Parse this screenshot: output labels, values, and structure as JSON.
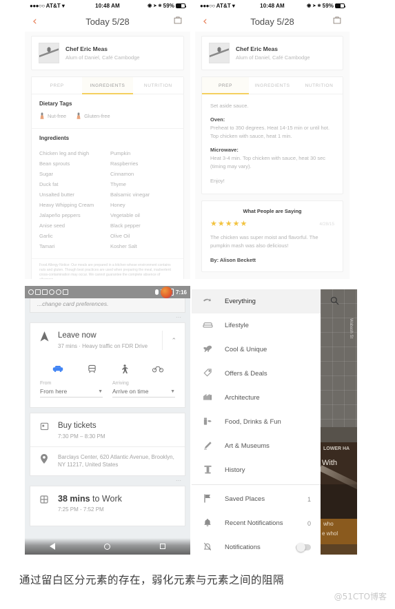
{
  "panels": {
    "recipe_ingredients": {
      "status": {
        "carrier": "AT&T",
        "dots": "●●●○○",
        "wifi": "▾",
        "time": "10:48 AM",
        "loc_icon": "➤",
        "bt": "✻",
        "battery": "59%"
      },
      "nav": {
        "back": "‹",
        "title": "Today 5/28",
        "bag": "bag-icon"
      },
      "chef": {
        "name": "Chef Eric Meas",
        "sub": "Alum of Daniel, Café Cambodge"
      },
      "tabs": [
        {
          "label": "PREP",
          "active": false
        },
        {
          "label": "INGREDIENTS",
          "active": true
        },
        {
          "label": "NUTRITION",
          "active": false
        }
      ],
      "dietary_title": "Dietary Tags",
      "dietary_tags": [
        "Nut-free",
        "Gluten-free"
      ],
      "ingredients_title": "Ingredients",
      "ingredients": [
        "Chicken leg and thigh",
        "Pumpkin",
        "Bean sprouts",
        "Raspberries",
        "Sugar",
        "Cinnamon",
        "Duck fat",
        "Thyme",
        "Unsalted butter",
        "Balsamic vinegar",
        "Heavy Whipping Cream",
        "Honey",
        "Jalapeño peppers",
        "Vegetable oil",
        "Anise seed",
        "Black pepper",
        "Garlic",
        "Olive Oil",
        "Tamari",
        "Kosher Salt"
      ],
      "allergy_notice": "Food Allergy Notice: Our meals are prepared in a kitchen whose environment contains nuts and gluten. Though best practices are used when preparing the meal, inadvertent cross-contamination may occur. We cannot guarantee the complete absence of allergens."
    },
    "recipe_prep": {
      "status": {
        "carrier": "AT&T",
        "dots": "●●●○○",
        "wifi": "▾",
        "time": "10:48 AM",
        "loc_icon": "➤",
        "bt": "✻",
        "battery": "59%"
      },
      "nav": {
        "back": "‹",
        "title": "Today 5/28",
        "bag": "bag-icon"
      },
      "chef": {
        "name": "Chef Eric Meas",
        "sub": "Alum of Daniel, Café Cambodge"
      },
      "tabs": [
        {
          "label": "PREP",
          "active": true
        },
        {
          "label": "INGREDIENTS",
          "active": false
        },
        {
          "label": "NUTRITION",
          "active": false
        }
      ],
      "prep": {
        "intro": "Set aside sauce.",
        "oven_head": "Oven:",
        "oven_body": "Preheat to 350 degrees. Heat 14-15 min or until hot. Top chicken with sauce, heat 1 min.",
        "micro_head": "Microwave:",
        "micro_body": "Heat 3-4 min.  Top chicken with sauce, heat 30 sec (timing may vary).",
        "enjoy": "Enjoy!"
      },
      "review": {
        "title": "What People are Saying",
        "stars": "★★★★★",
        "stars_count": 5,
        "date": "4/28/15",
        "text": "The chicken was super moist and flavorful. The pumpkin mash was also delicious!",
        "author": "By: Alison Beckett"
      }
    },
    "maps": {
      "status": {
        "time": "7:16"
      },
      "note": "...change card preferences.",
      "leave": {
        "title": "Leave now",
        "sub": "37 mins · Heavy traffic on FDR Drive",
        "chevron": "⌃"
      },
      "modes": [
        {
          "name": "driving-icon",
          "glyph": "🚗",
          "active": true
        },
        {
          "name": "transit-icon",
          "glyph": "🚆",
          "active": false
        },
        {
          "name": "walking-icon",
          "glyph": "🚶",
          "active": false
        },
        {
          "name": "cycling-icon",
          "glyph": "🚲",
          "active": false
        }
      ],
      "from": {
        "label": "From",
        "value": "From here"
      },
      "arriving": {
        "label": "Arriving",
        "value": "Arrive on time"
      },
      "tickets": {
        "title": "Buy tickets",
        "sub": "7:30 PM – 8:30 PM"
      },
      "address": "Barclays Center, 620 Atlantic Avenue, Brooklyn, NY 11217, United States",
      "commute": {
        "bold": "38 mins",
        "rest": " to Work",
        "sub": "7:25 PM - 7:52 PM"
      }
    },
    "drawer": {
      "items": [
        {
          "label": "Everything",
          "icon": "hand-pointer-icon",
          "glyph": "☞",
          "selected": true
        },
        {
          "label": "Lifestyle",
          "icon": "sofa-icon",
          "glyph": "🛋",
          "selected": false
        },
        {
          "label": "Cool & Unique",
          "icon": "dinosaur-icon",
          "glyph": "🦖",
          "selected": false
        },
        {
          "label": "Offers & Deals",
          "icon": "tag-icon",
          "glyph": "🏷",
          "selected": false
        },
        {
          "label": "Architecture",
          "icon": "building-icon",
          "glyph": "🏛",
          "selected": false
        },
        {
          "label": "Food, Drinks & Fun",
          "icon": "drink-icon",
          "glyph": "🍹",
          "selected": false
        },
        {
          "label": "Art & Museums",
          "icon": "palette-icon",
          "glyph": "🎨",
          "selected": false
        },
        {
          "label": "History",
          "icon": "column-icon",
          "glyph": "🏺",
          "selected": false
        }
      ],
      "items2": [
        {
          "label": "Saved Places",
          "icon": "flag-icon",
          "glyph": "⚑",
          "count": "1"
        },
        {
          "label": "Recent Notifications",
          "icon": "bell-icon",
          "glyph": "🔔",
          "count": "0"
        }
      ],
      "toggle_row": {
        "label": "Notifications",
        "icon": "bell-off-icon",
        "glyph": "🔕",
        "on": false
      },
      "map": {
        "search": "search-icon",
        "street": "Wabash St"
      },
      "photo": {
        "line1": "LOWER HA",
        "line2": "With",
        "line3": "who",
        "line4": "e whol"
      }
    }
  },
  "caption": {
    "text": "通过留白区分元素的存在，弱化元素与元素之间的阻隔",
    "watermark": "@51CTO博客"
  }
}
